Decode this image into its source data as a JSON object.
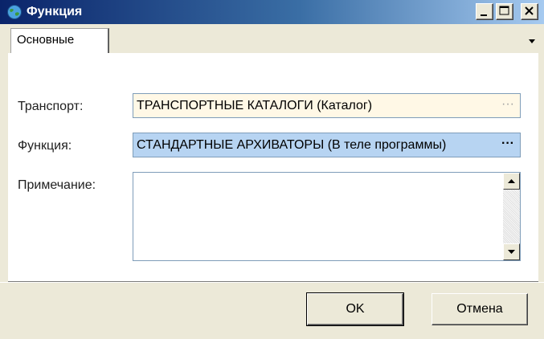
{
  "window": {
    "title": "Функция",
    "icon": "globe-icon",
    "controls": [
      "minimize-icon",
      "maximize-icon",
      "close-icon"
    ]
  },
  "tabs": [
    {
      "label": "Основные",
      "active": true
    }
  ],
  "form": {
    "transport_label": "Транспорт:",
    "transport_value": "ТРАНСПОРТНЫЕ КАТАЛОГИ (Каталог)",
    "function_label": "Функция:",
    "function_value": "СТАНДАРТНЫЕ АРХИВАТОРЫ (В теле программы)",
    "note_label": "Примечание:",
    "note_value": "",
    "ellipsis": "···"
  },
  "buttons": {
    "ok": "OK",
    "cancel": "Отмена"
  },
  "colors": {
    "titlebar_start": "#0a246a",
    "titlebar_end": "#a6caf0",
    "transport_bg": "#fff8e6",
    "function_bg": "#b7d4f2"
  }
}
